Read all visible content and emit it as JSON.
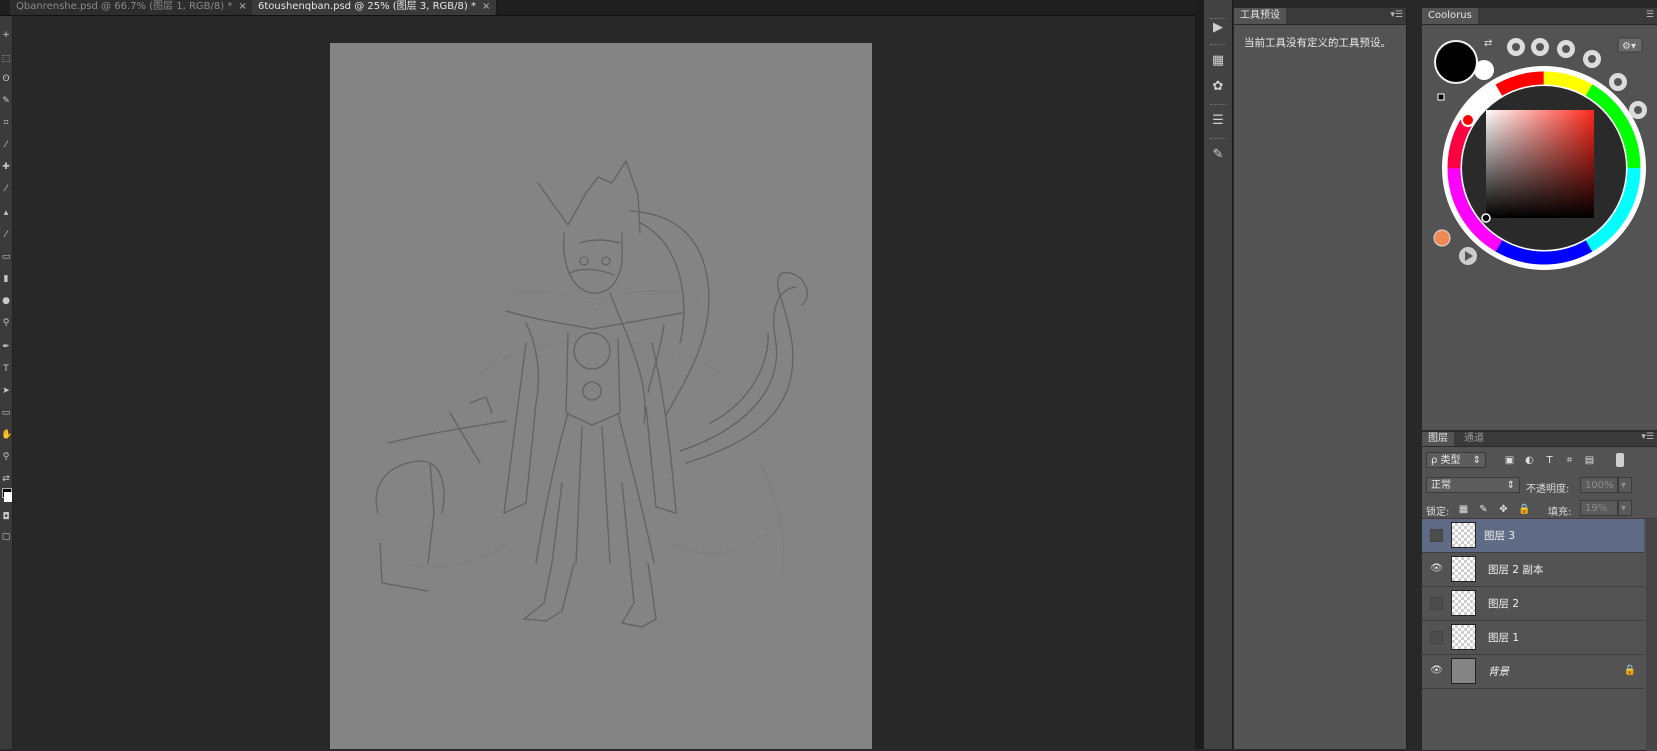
{
  "tabs": [
    {
      "label": "Qbanrenshe.psd @ 66.7% (图层 1, RGB/8) *",
      "close": "×"
    },
    {
      "label": "6toushenqban.psd @ 25% (图层 3, RGB/8) *",
      "close": "×"
    }
  ],
  "tools": [
    "move-tool",
    "marquee-tool",
    "lasso-tool",
    "quick-select-tool",
    "crop-tool",
    "eyedropper-tool",
    "healing-tool",
    "brush-tool",
    "clone-tool",
    "history-brush-tool",
    "eraser-tool",
    "gradient-tool",
    "blur-tool",
    "dodge-tool",
    "pen-tool",
    "type-tool",
    "path-select-tool",
    "shape-tool",
    "hand-tool",
    "zoom-tool",
    "default-colors",
    "foreground-color",
    "quick-mask",
    "screen-mode"
  ],
  "dock": {
    "icons": [
      "play-icon",
      "swatches-icon",
      "palette-icon",
      "adjust-icon",
      "brush-preset-icon"
    ]
  },
  "presets_panel": {
    "tab": "工具预设",
    "message": "当前工具没有定义的工具预设。"
  },
  "coolorus": {
    "tab": "Coolorus",
    "foreground": "#000000",
    "background": "#ffffff",
    "square_hue": "#ff2a1c"
  },
  "layers_panel": {
    "tabs": [
      "图层",
      "通道"
    ],
    "filter_label": "ρ 类型",
    "blend_mode": "正常",
    "opacity_label": "不透明度:",
    "opacity_value": "100%",
    "lock_label": "锁定:",
    "fill_label": "填充:",
    "fill_value": "19%",
    "layers": [
      {
        "name": "图层 3",
        "visible": false,
        "selected": true,
        "locked": false
      },
      {
        "name": "图层 2 副本",
        "visible": true,
        "selected": false,
        "locked": false
      },
      {
        "name": "图层 2",
        "visible": false,
        "selected": false,
        "locked": false
      },
      {
        "name": "图层 1",
        "visible": false,
        "selected": false,
        "locked": false
      },
      {
        "name": "背景",
        "visible": true,
        "selected": false,
        "locked": true
      }
    ]
  },
  "colors": {
    "app_bg": "#282828",
    "panel_bg": "#535353",
    "canvas_gray": "#848484",
    "selection_blue": "#5f6b85"
  }
}
